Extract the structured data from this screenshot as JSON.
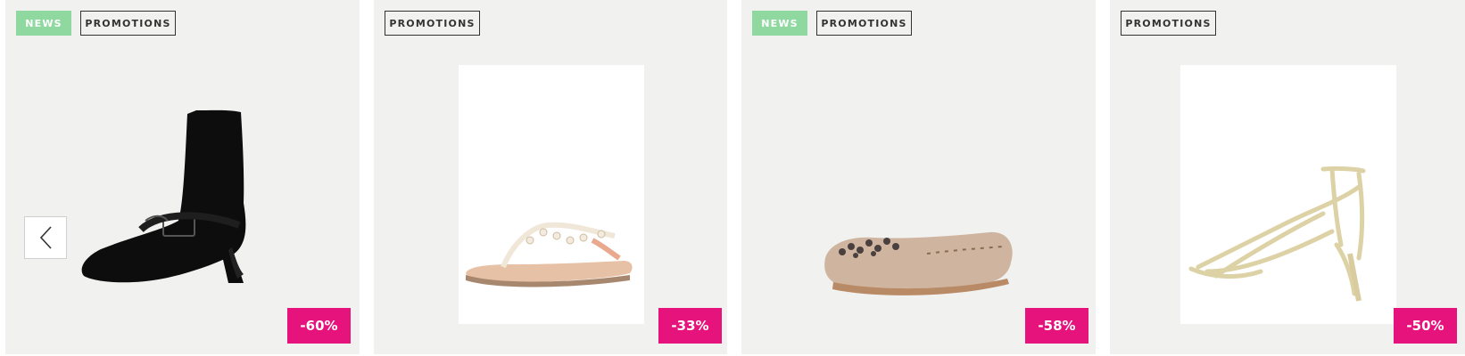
{
  "products": [
    {
      "tags": [
        "NEWS",
        "PROMOTIONS"
      ],
      "discount": "-60%",
      "image": "black-ankle-boot"
    },
    {
      "tags": [
        "PROMOTIONS"
      ],
      "discount": "-33%",
      "image": "jeweled-thong-sandal"
    },
    {
      "tags": [
        "NEWS",
        "PROMOTIONS"
      ],
      "discount": "-58%",
      "image": "embellished-suede-moccasin"
    },
    {
      "tags": [
        "PROMOTIONS"
      ],
      "discount": "-50%",
      "image": "gold-strappy-heel-sandal"
    }
  ],
  "carousel": {
    "prev_icon": "chevron-left-icon"
  },
  "colors": {
    "news_tag": "#8fd9a0",
    "discount_badge": "#e5137b",
    "card_bg": "#f1f1f0"
  }
}
